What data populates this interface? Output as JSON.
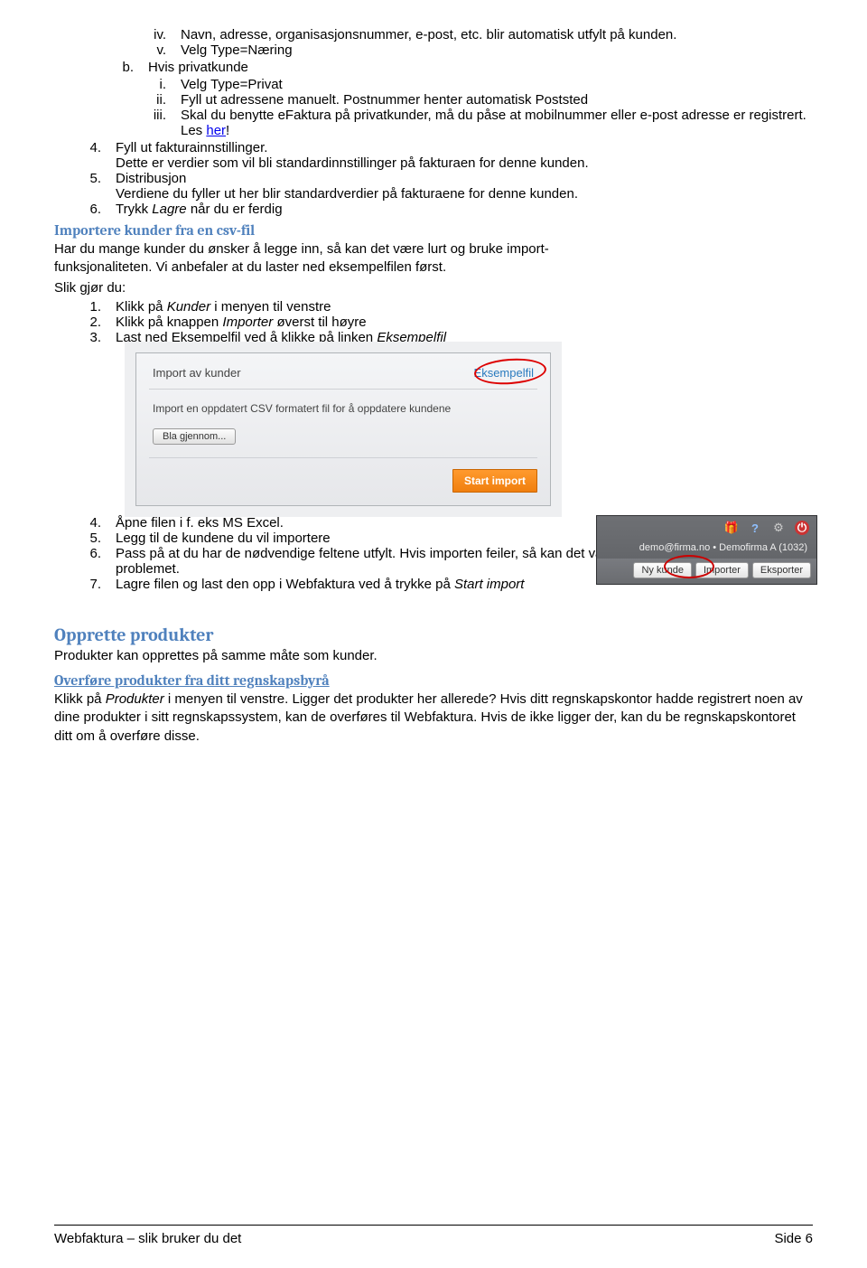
{
  "content": {
    "l4_iv_marker": "iv.",
    "l4_iv_text": "Navn, adresse, organisasjonsnummer, e-post, etc. blir automatisk utfylt på kunden.",
    "l4_v_marker": "v.",
    "l4_v_text": "Velg Type=Næring",
    "l3_b_marker": "b.",
    "l3_b_text": "Hvis privatkunde",
    "l4_i_marker": "i.",
    "l4_i_text": "Velg Type=Privat",
    "l4_ii_marker": "ii.",
    "l4_ii_text": "Fyll ut adressene manuelt. Postnummer henter automatisk Poststed",
    "l4_iii_marker": "iii.",
    "l4_iii_text_before": "Skal du benytte eFaktura på privatkunder, må du påse at mobilnummer eller e-post adresse er registrert. Les ",
    "l4_iii_link": "her",
    "l4_iii_text_after": "!",
    "l2_4_marker": "4.",
    "l2_4_line1": "Fyll ut fakturainnstillinger.",
    "l2_4_line2": "Dette er verdier som vil bli standardinnstillinger på fakturaen for denne kunden.",
    "l2_5_marker": "5.",
    "l2_5_line1": "Distribusjon",
    "l2_5_line2": "Verdiene du fyller ut her blir standardverdier på fakturaene for denne kunden.",
    "l2_6_marker": "6.",
    "l2_6_before": "Trykk ",
    "l2_6_italic": "Lagre",
    "l2_6_after": " når du er ferdig",
    "h3_import": "Importere kunder fra en csv-fil",
    "import_para": "Har du mange kunder du ønsker å legge inn, så kan det være lurt og bruke import-funksjonaliteten. Vi anbefaler at du laster ned eksempelfilen først.",
    "import_intro": "Slik gjør du:",
    "imp_1_before": "Klikk på ",
    "imp_1_italic": "Kunder",
    "imp_1_after": " i menyen til venstre",
    "imp_2_before": "Klikk på knappen ",
    "imp_2_italic": "Importer",
    "imp_2_after": " øverst til høyre",
    "imp_3_before": "Last ned Eksempelfil ved å klikke på linken ",
    "imp_3_italic": "Eksempelfil",
    "imp_4": "Åpne filen i f. eks MS Excel.",
    "imp_5": "Legg til de kundene du vil importere",
    "imp_6": "Pass på at du har de nødvendige feltene utfylt. Hvis importen feiler, så kan det være manglende data som er problemet.",
    "imp_7_before": "Lagre filen og last den opp i Webfaktura ved å trykke på ",
    "imp_7_italic": "Start import",
    "h2_products": "Opprette produkter",
    "products_para": "Produkter kan opprettes på samme måte som kunder.",
    "h3_transfer": "Overføre produkter fra ditt regnskapsbyrå",
    "transfer_before": "Klikk på ",
    "transfer_italic": "Produkter",
    "transfer_after": " i menyen til venstre. Ligger det produkter her allerede? Hvis ditt regnskapskontor hadde registrert noen av dine produkter i sitt regnskapssystem, kan de overføres til Webfaktura. Hvis de ikke ligger der, kan du be regnskapskontoret ditt om å overføre disse."
  },
  "list_markers": {
    "n1": "1.",
    "n2": "2.",
    "n3": "3.",
    "n4": "4.",
    "n5": "5.",
    "n6": "6.",
    "n7": "7."
  },
  "screenshot_toolbar": {
    "breadcrumb": "demo@firma.no • Demofirma A (1032)",
    "btn_ny": "Ny kunde",
    "btn_import": "Importer",
    "btn_export": "Eksporter",
    "icon_gift": "🎁",
    "icon_help": "?",
    "icon_gear": "⚙",
    "icon_power": "⏻"
  },
  "screenshot_import": {
    "title": "Import av kunder",
    "sample_link": "Eksempelfil",
    "desc": "Import en oppdatert CSV formatert fil for å oppdatere kundene",
    "browse_btn": "Bla gjennom...",
    "submit_btn": "Start import"
  },
  "footer": {
    "left": "Webfaktura – slik bruker du det",
    "right": "Side 6"
  }
}
